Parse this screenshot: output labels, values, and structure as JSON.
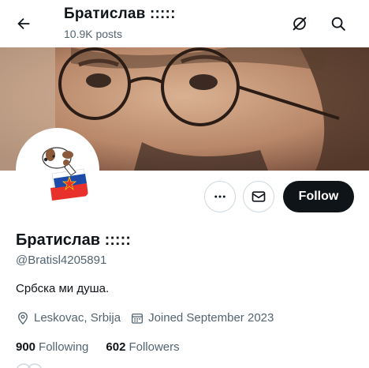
{
  "header": {
    "title": "Братислав :::::",
    "posts_count": "10.9K posts",
    "icons": [
      "back-arrow-icon",
      "grok-icon",
      "search-icon"
    ]
  },
  "profile": {
    "display_name": "Братислав :::::",
    "handle": "@Bratisl4205891",
    "bio": "Србска ми душа.",
    "location": "Leskovac, Srbija",
    "joined": "Joined September 2023",
    "following_count": "900",
    "following_label": "Following",
    "followers_count": "602",
    "followers_label": "Followers"
  },
  "actions": {
    "more_icon": "more-dots-icon",
    "message_icon": "envelope-icon",
    "follow_label": "Follow"
  },
  "colors": {
    "text": "#0f1419",
    "secondary": "#536471",
    "follow_bg": "#0f1419",
    "border": "#cfd9de"
  }
}
